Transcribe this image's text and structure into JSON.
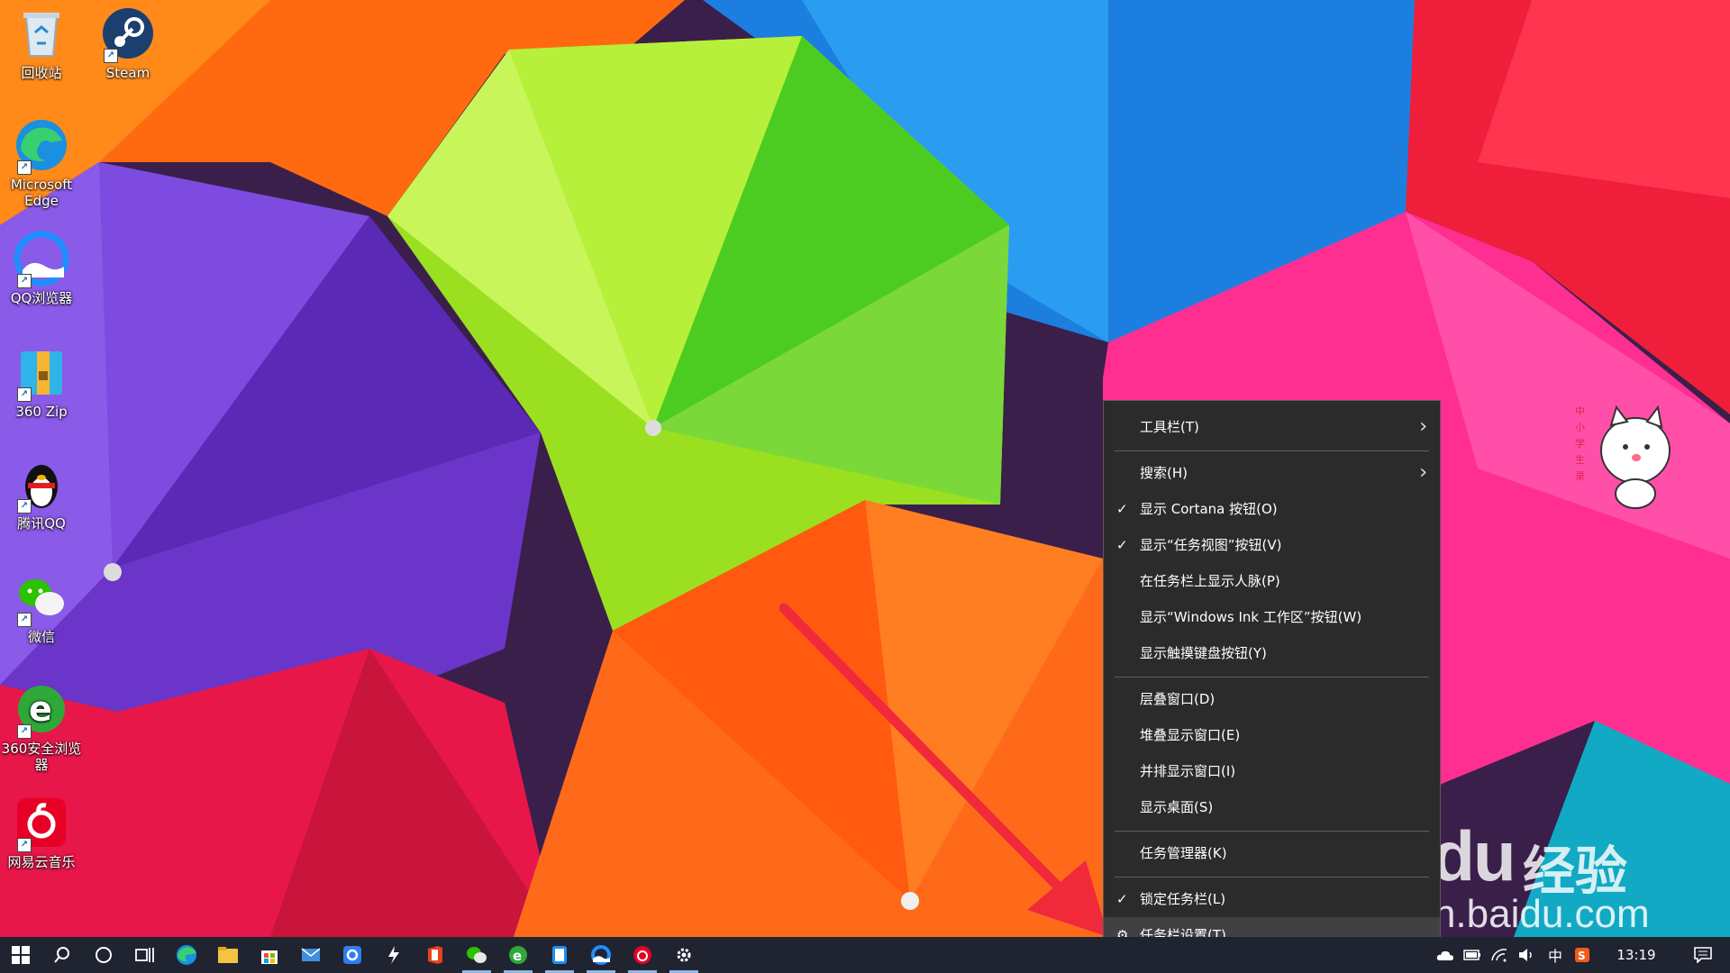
{
  "desktop": {
    "icons": [
      {
        "label": "回收站"
      },
      {
        "label": "Steam"
      },
      {
        "label": "Microsoft Edge"
      },
      {
        "label": "QQ浏览器"
      },
      {
        "label": "360 Zip"
      },
      {
        "label": "腾讯QQ"
      },
      {
        "label": "微信"
      },
      {
        "label": "360安全浏览器"
      },
      {
        "label": "网易云音乐"
      }
    ]
  },
  "context_menu": {
    "items": [
      {
        "label": "工具栏(T)",
        "has_submenu": true,
        "checked": false
      },
      {
        "label": "搜索(H)",
        "has_submenu": true,
        "checked": false
      },
      {
        "label": "显示 Cortana 按钮(O)",
        "has_submenu": false,
        "checked": true
      },
      {
        "label": "显示“任务视图”按钮(V)",
        "has_submenu": false,
        "checked": true
      },
      {
        "label": "在任务栏上显示人脉(P)",
        "has_submenu": false,
        "checked": false
      },
      {
        "label": "显示“Windows Ink 工作区”按钮(W)",
        "has_submenu": false,
        "checked": false
      },
      {
        "label": "显示触摸键盘按钮(Y)",
        "has_submenu": false,
        "checked": false
      },
      {
        "label": "层叠窗口(D)",
        "has_submenu": false,
        "checked": false
      },
      {
        "label": "堆叠显示窗口(E)",
        "has_submenu": false,
        "checked": false
      },
      {
        "label": "并排显示窗口(I)",
        "has_submenu": false,
        "checked": false
      },
      {
        "label": "显示桌面(S)",
        "has_submenu": false,
        "checked": false
      },
      {
        "label": "任务管理器(K)",
        "has_submenu": false,
        "checked": false
      },
      {
        "label": "锁定任务栏(L)",
        "has_submenu": false,
        "checked": true
      },
      {
        "label": "任务栏设置(T)",
        "has_submenu": false,
        "checked": false,
        "highlighted": true
      }
    ]
  },
  "taskbar": {
    "apps": [
      "start",
      "search",
      "cortana",
      "task-view",
      "edge",
      "file-explorer",
      "store",
      "mail",
      "app-blue",
      "app-bolt",
      "office",
      "wechat",
      "360-browser",
      "app-note",
      "qq-browser",
      "netease-music",
      "settings"
    ],
    "tray": {
      "ime": "中",
      "time": "13:19"
    }
  },
  "watermark": {
    "brand": "Baidu",
    "jing": "经验",
    "url": "jingyan.baidu.com"
  },
  "colors": {
    "menu_bg": "#2b2b2b",
    "menu_hover": "#414141",
    "taskbar_bg": "#202431",
    "arrow": "#f02a3a"
  }
}
